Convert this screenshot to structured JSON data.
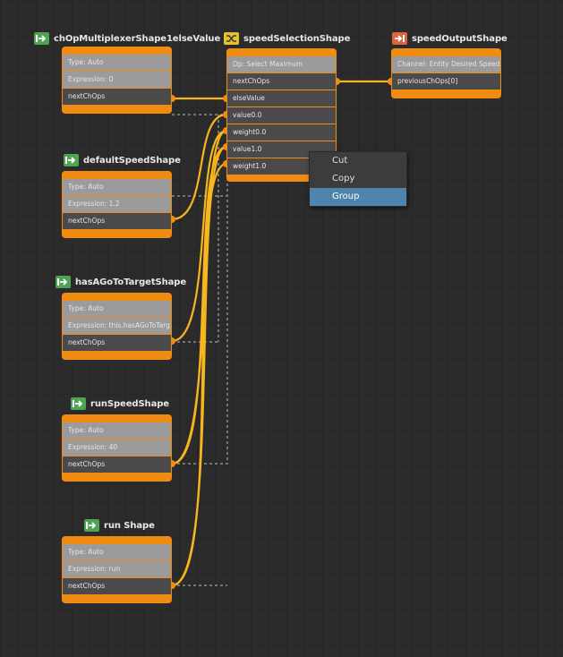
{
  "nodes": {
    "chop_multiplexer": {
      "title": "chOpMultiplexerShape1elseValue",
      "icon": "input-arrow-icon",
      "rows": {
        "type": "Type: Auto",
        "expression": "Expression: 0",
        "next": "nextChOps"
      }
    },
    "speed_selection": {
      "title": "speedSelectionShape",
      "icon": "shuffle-icon",
      "rows": {
        "op": "Op: Select Maximum",
        "next": "nextChOps",
        "else_value": "elseValue",
        "value0": "value0.0",
        "weight0": "weight0.0",
        "value1": "value1.0",
        "weight1": "weight1.0"
      }
    },
    "speed_output": {
      "title": "speedOutputShape",
      "icon": "output-arrow-icon",
      "rows": {
        "channel": "Channel: Entity Desired Speed",
        "previous": "previousChOps[0]"
      }
    },
    "default_speed": {
      "title": "defaultSpeedShape",
      "icon": "input-arrow-icon",
      "rows": {
        "type": "Type: Auto",
        "expression": "Expression: 1.2",
        "next": "nextChOps"
      }
    },
    "has_goto_target": {
      "title": "hasAGoToTargetShape",
      "icon": "input-arrow-icon",
      "rows": {
        "type": "Type: Auto",
        "expression": "Expression: this.hasAGoToTarg",
        "next": "nextChOps"
      }
    },
    "run_speed": {
      "title": "runSpeedShape",
      "icon": "input-arrow-icon",
      "rows": {
        "type": "Type: Auto",
        "expression": "Expression: 40",
        "next": "nextChOps"
      }
    },
    "run": {
      "title": "run Shape",
      "icon": "input-arrow-icon",
      "rows": {
        "type": "Type: Auto",
        "expression": "Expression: run",
        "next": "nextChOps"
      }
    }
  },
  "context_menu": {
    "items": [
      "Cut",
      "Copy",
      "Group"
    ],
    "highlighted": "Group"
  },
  "colors": {
    "node_body": "#f08c12",
    "wire": "#f7b51e",
    "dashed_wire": "#bdbdbd",
    "plug_port": "#f08c12",
    "menu_highlight": "#4f84ad",
    "input_icon": "#4fa354",
    "selection_icon": "#e2c12b",
    "output_icon": "#d9663e"
  }
}
